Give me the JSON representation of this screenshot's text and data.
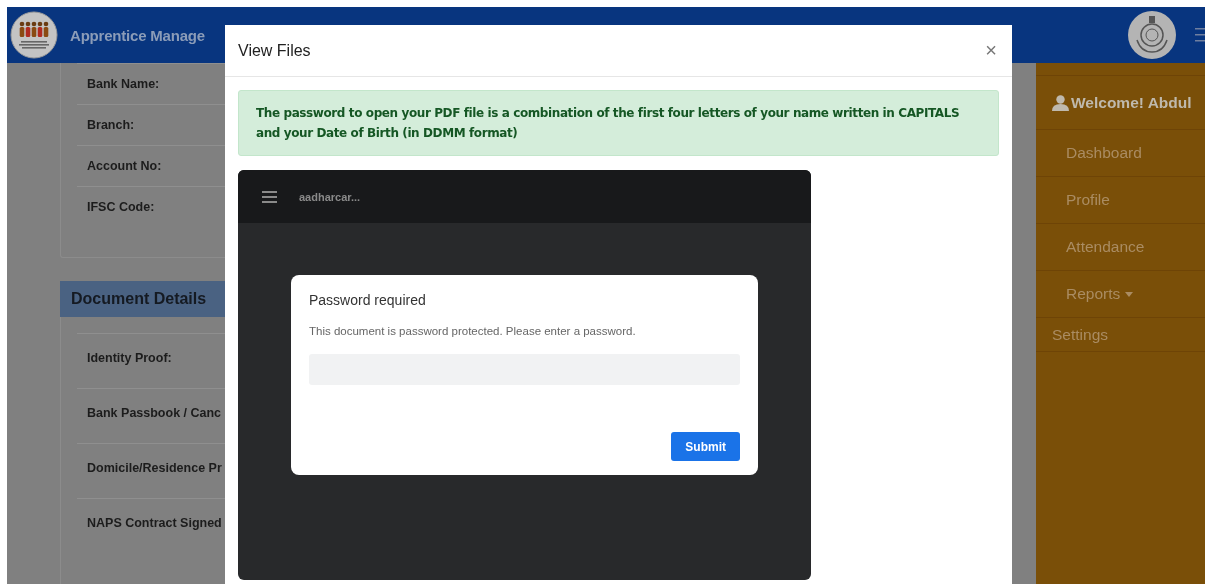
{
  "header": {
    "title": "Apprentice Manage"
  },
  "bank_details": {
    "labels": [
      "Bank Name:",
      "Branch:",
      "Account No:",
      "IFSC Code:"
    ]
  },
  "document_details": {
    "title": "Document Details",
    "labels": [
      "Identity Proof:",
      "Bank Passbook / Canc",
      "Domicile/Residence Pr",
      "NAPS Contract Signed"
    ]
  },
  "modal": {
    "title": "View Files",
    "close": "×",
    "notice": "The password to open your PDF file is a combination of the first four letters of your name written in CAPITALS and your Date of Birth (in DDMM format)",
    "viewer": {
      "file_name": "aadharcar...",
      "dialog": {
        "title": "Password required",
        "message": "This document is password protected. Please enter a password.",
        "submit": "Submit"
      }
    }
  },
  "sidebar": {
    "welcome": "Welcome! Abdul",
    "items": [
      {
        "label": "Dashboard",
        "kind": "link"
      },
      {
        "label": "Profile",
        "kind": "link"
      },
      {
        "label": "Attendance",
        "kind": "link"
      },
      {
        "label": "Reports",
        "kind": "dropdown"
      },
      {
        "label": "Settings",
        "kind": "top"
      }
    ]
  }
}
